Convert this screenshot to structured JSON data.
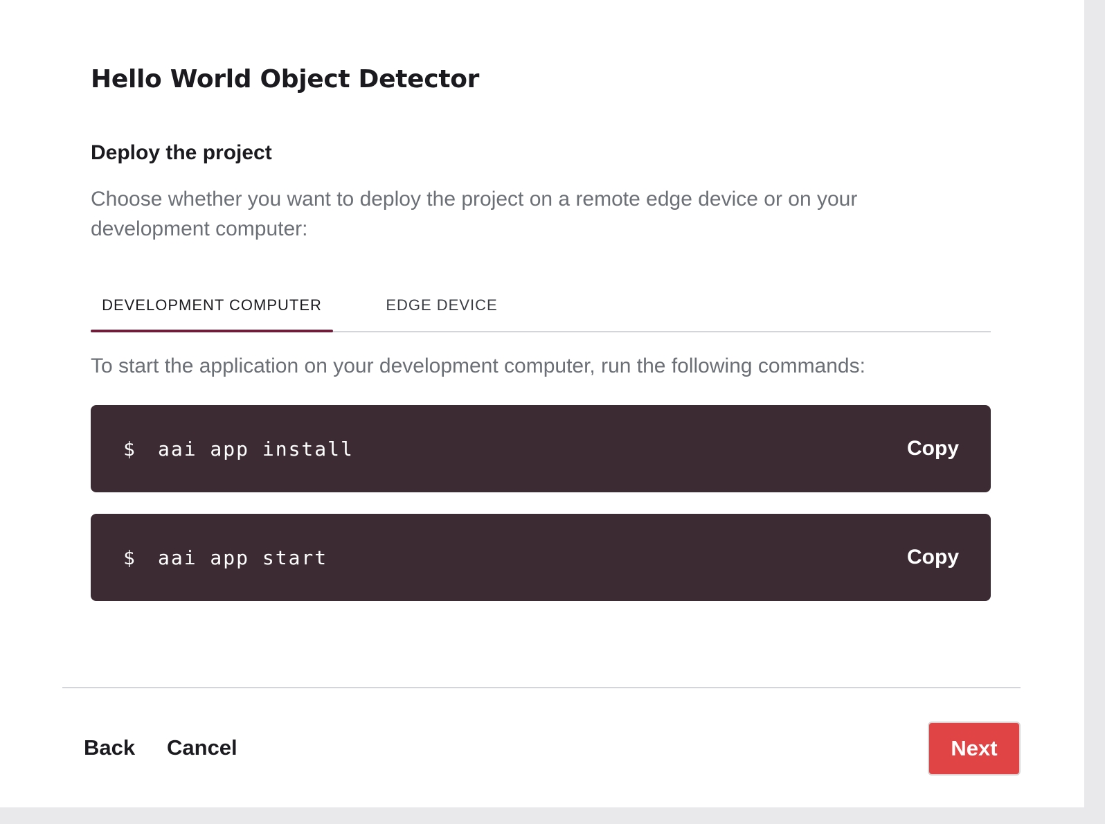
{
  "dialog": {
    "title": "Hello World Object Detector",
    "section_title": "Deploy the project",
    "description": "Choose whether you want to deploy the project on a remote edge device or on your development computer:"
  },
  "tabs": [
    {
      "label": "DEVELOPMENT COMPUTER",
      "active": true
    },
    {
      "label": "EDGE DEVICE",
      "active": false
    }
  ],
  "instruction": "To start the application on your development computer, run the following commands:",
  "commands": [
    {
      "prompt": "$",
      "text": "aai app install",
      "copy_label": "Copy"
    },
    {
      "prompt": "$",
      "text": "aai app start",
      "copy_label": "Copy"
    }
  ],
  "footer": {
    "back_label": "Back",
    "cancel_label": "Cancel",
    "next_label": "Next"
  },
  "colors": {
    "accent": "#6f1e3a",
    "command_bg": "#3d2b33",
    "primary_button": "#e04444",
    "muted_text": "#6b6f76"
  }
}
